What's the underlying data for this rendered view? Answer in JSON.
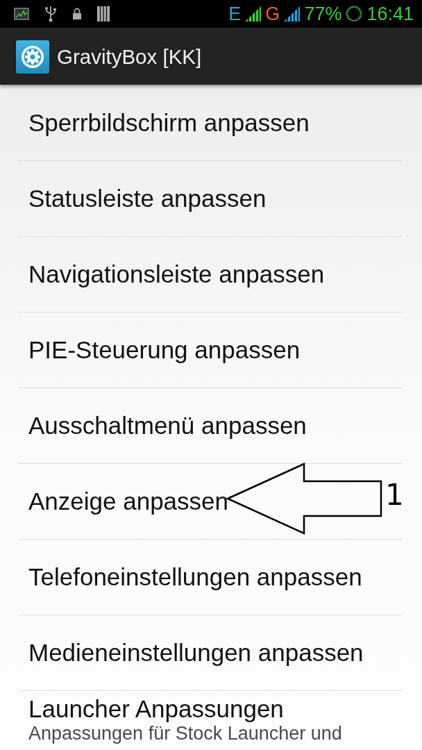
{
  "status_bar": {
    "network_labels": [
      {
        "text": "E",
        "color": "#2b9fd4"
      },
      {
        "text": "G",
        "color": "#e2661c"
      }
    ],
    "battery": "77%",
    "time": "16:41"
  },
  "action_bar": {
    "title": "GravityBox [KK]"
  },
  "menu_items": [
    {
      "title": "Sperrbildschirm anpassen"
    },
    {
      "title": "Statusleiste anpassen"
    },
    {
      "title": "Navigationsleiste anpassen"
    },
    {
      "title": "PIE-Steuerung anpassen"
    },
    {
      "title": "Ausschaltmenü anpassen"
    },
    {
      "title": "Anzeige anpassen"
    },
    {
      "title": "Telefoneinstellungen anpassen"
    },
    {
      "title": "Medieneinstellungen anpassen"
    },
    {
      "title": "Launcher Anpassungen",
      "summary": "Anpassungen für Stock Launcher und"
    }
  ],
  "annotation": {
    "label": "1"
  }
}
